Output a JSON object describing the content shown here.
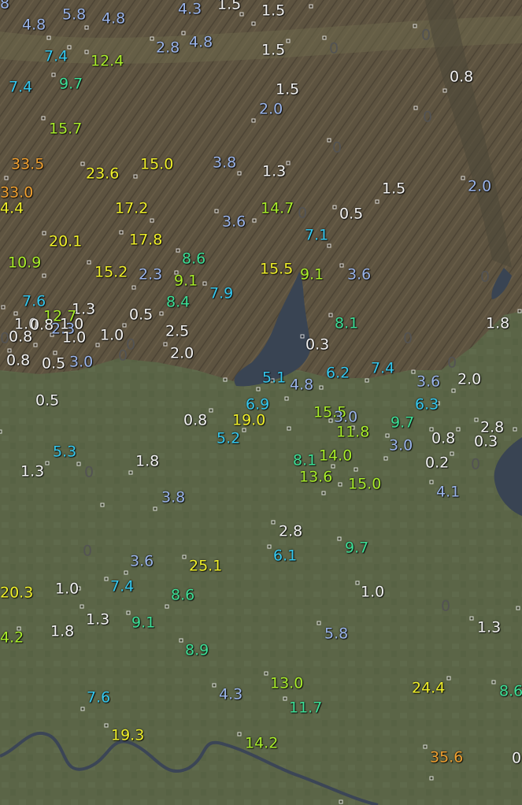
{
  "map": {
    "colors": {
      "mountain": "#5d5340",
      "mountain_dark": "#3f382b",
      "plain": "#5b6547",
      "lake": "#394453",
      "river": "#3b4556",
      "value_white": "#f2f2f2",
      "value_light_blue": "#9ab4ea",
      "value_cyan": "#35c8ef",
      "value_green": "#3ddf96",
      "value_lime": "#a9ee2b",
      "value_yellow": "#f0f02a",
      "value_orange": "#f0a030",
      "zero_gray": "#535353"
    },
    "readings": [
      {
        "text": "4.8",
        "color": "#9ab4ea"
      },
      {
        "text": "5.8",
        "color": "#9ab4ea"
      },
      {
        "text": "4.8",
        "color": "#9ab4ea"
      },
      {
        "text": "4.3",
        "color": "#9ab4ea"
      },
      {
        "text": "1.5",
        "color": "#f2f2f2"
      },
      {
        "text": "1.5",
        "color": "#f2f2f2"
      },
      {
        "text": "2.8",
        "color": "#9ab4ea"
      },
      {
        "text": "4.8",
        "color": "#9ab4ea"
      },
      {
        "text": "1.5",
        "color": "#f2f2f2"
      },
      {
        "text": "7.4",
        "color": "#35c8ef"
      },
      {
        "text": "12.4",
        "color": "#a9ee2b"
      },
      {
        "text": "7.4",
        "color": "#35c8ef"
      },
      {
        "text": "9.7",
        "color": "#3ddf96"
      },
      {
        "text": "1.5",
        "color": "#f2f2f2"
      },
      {
        "text": "0.8",
        "color": "#f2f2f2"
      },
      {
        "text": "2.0",
        "color": "#9ab4ea"
      },
      {
        "text": "15.7",
        "color": "#a9ee2b"
      },
      {
        "text": "33.5",
        "color": "#f0a030"
      },
      {
        "text": "23.6",
        "color": "#f0f02a"
      },
      {
        "text": "15.0",
        "color": "#f0f02a"
      },
      {
        "text": "3.8",
        "color": "#9ab4ea"
      },
      {
        "text": "1.3",
        "color": "#f2f2f2"
      },
      {
        "text": "1.5",
        "color": "#f2f2f2"
      },
      {
        "text": "2.0",
        "color": "#9ab4ea"
      },
      {
        "text": "33.0",
        "color": "#f0a030"
      },
      {
        "text": "4.4",
        "color": "#f0f02a"
      },
      {
        "text": "17.2",
        "color": "#f0f02a"
      },
      {
        "text": "3.6",
        "color": "#9ab4ea"
      },
      {
        "text": "14.7",
        "color": "#a9ee2b"
      },
      {
        "text": "0.5",
        "color": "#f2f2f2"
      },
      {
        "text": "20.1",
        "color": "#f0f02a"
      },
      {
        "text": "17.8",
        "color": "#f0f02a"
      },
      {
        "text": "7.1",
        "color": "#35c8ef"
      },
      {
        "text": "10.9",
        "color": "#a9ee2b"
      },
      {
        "text": "8.6",
        "color": "#3ddf96"
      },
      {
        "text": "15.2",
        "color": "#f0f02a"
      },
      {
        "text": "2.3",
        "color": "#9ab4ea"
      },
      {
        "text": "15.5",
        "color": "#f0f02a"
      },
      {
        "text": "9.1",
        "color": "#a9ee2b"
      },
      {
        "text": "3.6",
        "color": "#9ab4ea"
      },
      {
        "text": "9.1",
        "color": "#a9ee2b"
      },
      {
        "text": "7.9",
        "color": "#35c8ef"
      },
      {
        "text": "7.6",
        "color": "#35c8ef"
      },
      {
        "text": "8.4",
        "color": "#3ddf96"
      },
      {
        "text": "1.3",
        "color": "#f2f2f2"
      },
      {
        "text": "12.7",
        "color": "#a9ee2b"
      },
      {
        "text": "0.5",
        "color": "#f2f2f2"
      },
      {
        "text": "1.0",
        "color": "#f2f2f2"
      },
      {
        "text": "1.0",
        "color": "#f2f2f2"
      },
      {
        "text": "0.8",
        "color": "#f2f2f2"
      },
      {
        "text": "2.3",
        "color": "#9ab4ea"
      },
      {
        "text": "2.5",
        "color": "#f2f2f2"
      },
      {
        "text": "8.1",
        "color": "#3ddf96"
      },
      {
        "text": "1.8",
        "color": "#f2f2f2"
      },
      {
        "text": "0.8",
        "color": "#f2f2f2"
      },
      {
        "text": "1.0",
        "color": "#f2f2f2"
      },
      {
        "text": "1.0",
        "color": "#f2f2f2"
      },
      {
        "text": "0.3",
        "color": "#f2f2f2"
      },
      {
        "text": "2.0",
        "color": "#f2f2f2"
      },
      {
        "text": "0.8",
        "color": "#f2f2f2"
      },
      {
        "text": "0.5",
        "color": "#f2f2f2"
      },
      {
        "text": "3.0",
        "color": "#9ab4ea"
      },
      {
        "text": "6.2",
        "color": "#35c8ef"
      },
      {
        "text": "7.4",
        "color": "#35c8ef"
      },
      {
        "text": "5.1",
        "color": "#35c8ef"
      },
      {
        "text": "4.8",
        "color": "#9ab4ea"
      },
      {
        "text": "3.6",
        "color": "#9ab4ea"
      },
      {
        "text": "2.0",
        "color": "#f2f2f2"
      },
      {
        "text": "0.5",
        "color": "#f2f2f2"
      },
      {
        "text": "6.9",
        "color": "#35c8ef"
      },
      {
        "text": "15.5",
        "color": "#a9ee2b"
      },
      {
        "text": "6.3",
        "color": "#35c8ef"
      },
      {
        "text": "0.8",
        "color": "#f2f2f2"
      },
      {
        "text": "19.0",
        "color": "#f0f02a"
      },
      {
        "text": "3.0",
        "color": "#9ab4ea"
      },
      {
        "text": "9.7",
        "color": "#3ddf96"
      },
      {
        "text": "2.8",
        "color": "#f2f2f2"
      },
      {
        "text": "5.2",
        "color": "#35c8ef"
      },
      {
        "text": "11.8",
        "color": "#a9ee2b"
      },
      {
        "text": "0.8",
        "color": "#f2f2f2"
      },
      {
        "text": "0.3",
        "color": "#f2f2f2"
      },
      {
        "text": "3.0",
        "color": "#9ab4ea"
      },
      {
        "text": "5.3",
        "color": "#35c8ef"
      },
      {
        "text": "14.0",
        "color": "#a9ee2b"
      },
      {
        "text": "1.3",
        "color": "#f2f2f2"
      },
      {
        "text": "1.8",
        "color": "#f2f2f2"
      },
      {
        "text": "8.1",
        "color": "#3ddf96"
      },
      {
        "text": "0.2",
        "color": "#f2f2f2"
      },
      {
        "text": "13.6",
        "color": "#a9ee2b"
      },
      {
        "text": "15.0",
        "color": "#a9ee2b"
      },
      {
        "text": "4.1",
        "color": "#9ab4ea"
      },
      {
        "text": "3.8",
        "color": "#9ab4ea"
      },
      {
        "text": "2.8",
        "color": "#f2f2f2"
      },
      {
        "text": "9.7",
        "color": "#3ddf96"
      },
      {
        "text": "6.1",
        "color": "#35c8ef"
      },
      {
        "text": "3.6",
        "color": "#9ab4ea"
      },
      {
        "text": "25.1",
        "color": "#f0f02a"
      },
      {
        "text": "7.4",
        "color": "#35c8ef"
      },
      {
        "text": "20.3",
        "color": "#f0f02a"
      },
      {
        "text": "1.0",
        "color": "#f2f2f2"
      },
      {
        "text": "8.6",
        "color": "#3ddf96"
      },
      {
        "text": "1.0",
        "color": "#f2f2f2"
      },
      {
        "text": "1.3",
        "color": "#f2f2f2"
      },
      {
        "text": "9.1",
        "color": "#3ddf96"
      },
      {
        "text": "1.3",
        "color": "#f2f2f2"
      },
      {
        "text": "4.2",
        "color": "#a9ee2b"
      },
      {
        "text": "1.8",
        "color": "#f2f2f2"
      },
      {
        "text": "5.8",
        "color": "#9ab4ea"
      },
      {
        "text": "8.9",
        "color": "#3ddf96"
      },
      {
        "text": "13.0",
        "color": "#a9ee2b"
      },
      {
        "text": "24.4",
        "color": "#f0f02a"
      },
      {
        "text": "8.6",
        "color": "#3ddf96"
      },
      {
        "text": "7.6",
        "color": "#35c8ef"
      },
      {
        "text": "4.3",
        "color": "#9ab4ea"
      },
      {
        "text": "11.7",
        "color": "#3ddf96"
      },
      {
        "text": "19.3",
        "color": "#f0f02a"
      },
      {
        "text": "14.2",
        "color": "#a9ee2b"
      },
      {
        "text": "35.6",
        "color": "#f0a030"
      },
      {
        "text": "0",
        "color": "#f2f2f2"
      },
      {
        "text": "8",
        "color": "#9ab4ea"
      }
    ],
    "zeros": [
      "0",
      "0",
      "0",
      "0",
      "0",
      "0",
      "0",
      "0",
      "0",
      "0",
      "0",
      "0",
      "0",
      "0",
      "0"
    ]
  }
}
